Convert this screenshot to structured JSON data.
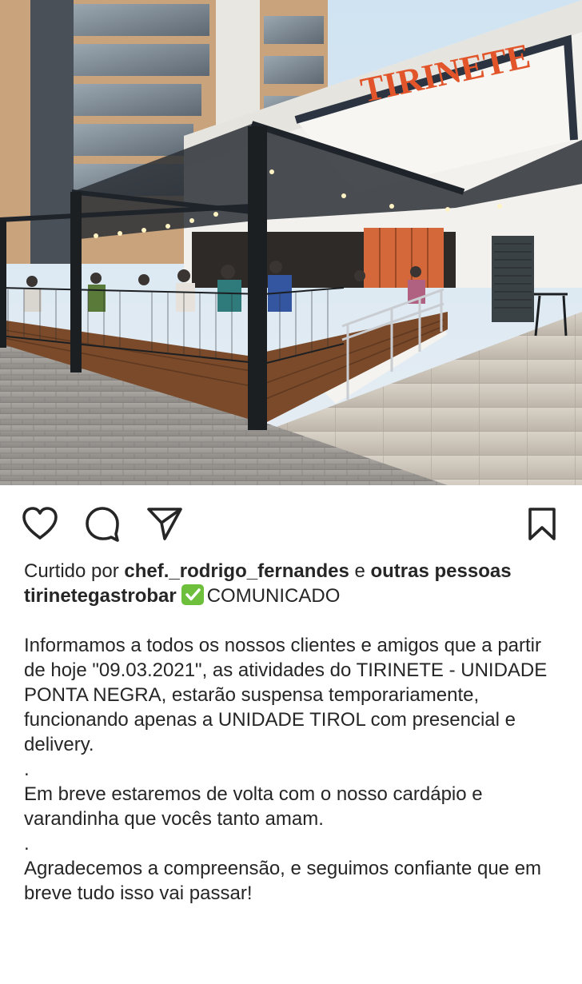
{
  "post_image": {
    "sign_text": "TIRINETE"
  },
  "actions": {
    "like_icon": "heart-icon",
    "comment_icon": "comment-icon",
    "share_icon": "paper-plane-icon",
    "save_icon": "bookmark-icon"
  },
  "likes": {
    "prefix": "Curtido por ",
    "user": "chef._rodrigo_fernandes",
    "middle": " e ",
    "others": "outras pessoas"
  },
  "caption": {
    "username": "tirinetegastrobar",
    "check_icon": "check-mark-button-emoji",
    "headline": "COMUNICADO",
    "paragraph_1": "Informamos a todos os nossos clientes e amigos que a partir de hoje \"09.03.2021\", as atividades do TIRINETE - UNIDADE PONTA NEGRA, estarão suspensa temporariamente, funcionando apenas a UNIDADE TIROL com presencial e delivery.",
    "separator_1": ".",
    "paragraph_2": "Em breve estaremos de volta com o nosso cardápio e varandinha que vocês tanto amam.",
    "separator_2": ".",
    "paragraph_3": "Agradecemos a compreensão, e seguimos confiante que em breve tudo isso vai passar!"
  },
  "colors": {
    "text": "#262626",
    "sign_orange": "#e2552a",
    "check_green": "#6dbf3c"
  }
}
